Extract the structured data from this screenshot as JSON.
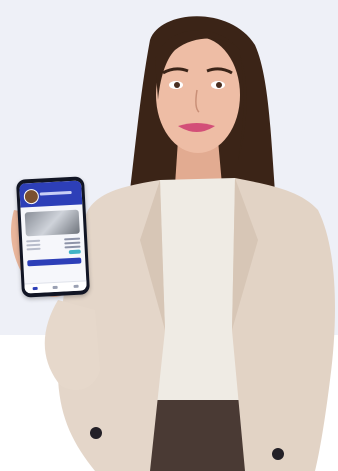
{
  "scene": {
    "description_colors": {
      "background_top": "#eef0f7",
      "background_bottom": "#ffffff",
      "blazer": "#e4d6c9",
      "top": "#efebe4",
      "hair": "#3b2417",
      "skin": "#e8b59c",
      "lips": "#d34f78",
      "phone_accent": "#2d3fb8"
    },
    "phone": {
      "icons": [
        "user-icon",
        "home-icon",
        "cart-icon"
      ]
    }
  }
}
